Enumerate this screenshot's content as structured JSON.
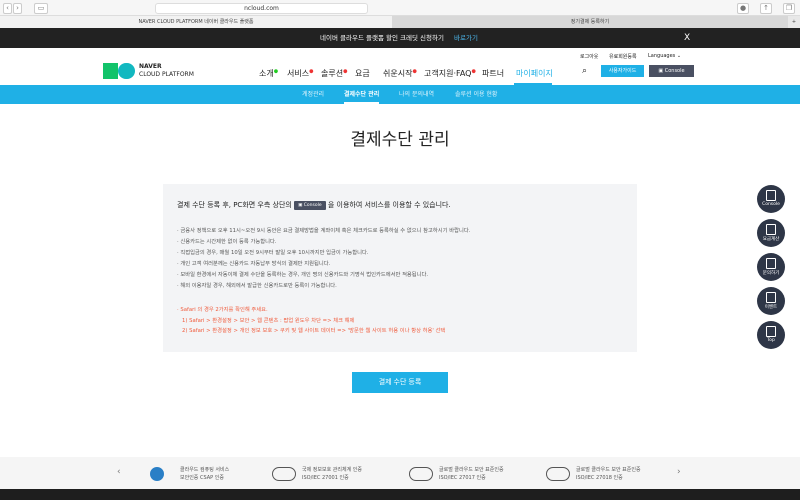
{
  "browser": {
    "url": "ncloud.com",
    "tabs": [
      "NAVER CLOUD PLATFORM 네이버 클라우드 플랫폼",
      "정기결제 등록하기"
    ]
  },
  "banner": {
    "text": "네이버 클라우드 플랫폼 할인 크레딧 신청하기",
    "link": "바로가기",
    "close": "X"
  },
  "header": {
    "logo_line1": "NAVER",
    "logo_line2": "CLOUD PLATFORM",
    "util": [
      "로그아웃",
      "유료회원등록",
      "Languages"
    ],
    "nav": [
      "소개",
      "서비스",
      "솔루션",
      "요금",
      "쉬운시작",
      "고객지원·FAQ",
      "파트너",
      "마이페이지"
    ],
    "guide_button": "사용자가이드",
    "console_button": "Console"
  },
  "subnav": [
    "계정관리",
    "결제수단 관리",
    "나의 문의내역",
    "솔루션 이용 현황"
  ],
  "page_title": "결제수단 관리",
  "info": {
    "lead_before": "결제 수단 등록 후, PC화면 우측 상단의",
    "lead_console": "Console",
    "lead_after": "을 이용하여 서비스를 이용할 수 있습니다.",
    "bullets": [
      "금융사 정책으로 오후 11시~오전 9시 동안은 요금 결제방법을 계좌이체 혹은 체크카드로 등록하실 수 없으니 참고하시기 바랍니다.",
      "신용카드는 시간제한 없이 등록 가능합니다.",
      "직접입금의 경우, 매월 10일 오전 9시부터 말일 오후 10시까지만 입금이 가능합니다.",
      "개인 고객 여러분께는 신용카드 자동납부 방식의 결제만 지원됩니다.",
      "모바일 환경에서 자동이체 결제 수단을 등록하는 경우, 개인 명의 신용카드와 기명식 법인카드에서만 적용됩니다.",
      "해외 이용자일 경우, 해외에서 발급한 신용카드로만 등록이 가능합니다."
    ],
    "safari": [
      "· Safari 의 경우 2가지를 확인해 주세요.",
      "1) Safari > 환경설정 > 보안 > 웹 콘텐츠 : 팝업 윈도우 차단 => 체크 해제",
      "2) Safari > 환경설정 > 개인 정보 보호 > 쿠키 및 웹 사이트 데이터 => '방문한 웹 사이트 허용 이나 항상 허용' 선택"
    ]
  },
  "register_button": "결제 수단 등록",
  "floating": [
    "Console",
    "요금계산",
    "문의하기",
    "이벤트",
    "Top"
  ],
  "footer": {
    "certs": [
      [
        "클라우드 컴퓨팅 서비스",
        "보안인증 CSAP 인증"
      ],
      [
        "국제 정보보호 관리체계 인증",
        "ISO/IEC 27001 인증"
      ],
      [
        "글로벌 클라우드 보안 표준인증",
        "ISO/IEC 27017 인증"
      ],
      [
        "글로벌 클라우드 보안 표준인증",
        "ISO/IEC 27018 인증"
      ]
    ],
    "prev": "‹",
    "next": "›"
  },
  "colors": {
    "accent": "#1fb0e6",
    "warning": "#f05a3b"
  }
}
